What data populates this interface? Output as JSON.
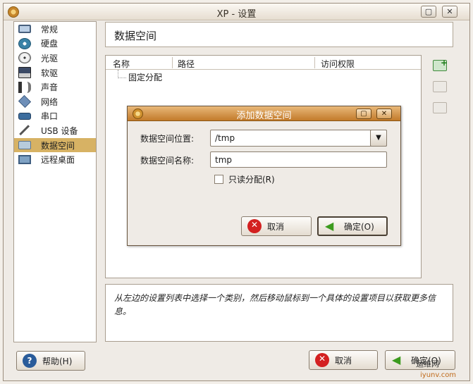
{
  "window": {
    "title": "XP - 设置",
    "controls": {
      "maximize": "▢",
      "close": "✕"
    }
  },
  "sidebar": {
    "items": [
      {
        "label": "常规",
        "icon": "computer-icon"
      },
      {
        "label": "硬盘",
        "icon": "hard-disk-icon"
      },
      {
        "label": "光驱",
        "icon": "cd-rom-icon"
      },
      {
        "label": "软驱",
        "icon": "floppy-icon"
      },
      {
        "label": "声音",
        "icon": "audio-icon"
      },
      {
        "label": "网络",
        "icon": "network-icon"
      },
      {
        "label": "串口",
        "icon": "serial-port-icon"
      },
      {
        "label": "USB 设备",
        "icon": "usb-icon"
      },
      {
        "label": "数据空间",
        "icon": "shared-folder-icon",
        "selected": true
      },
      {
        "label": "远程桌面",
        "icon": "remote-display-icon"
      }
    ]
  },
  "header": {
    "title": "数据空间"
  },
  "table": {
    "columns": [
      "名称",
      "路径",
      "访问权限"
    ],
    "rows": [
      {
        "name": "固定分配"
      }
    ]
  },
  "info": {
    "text": "从左边的设置列表中选择一个类别，然后移动鼠标到一个具体的设置项目以获取更多信息。"
  },
  "buttons": {
    "help": "帮助(H)",
    "cancel": "取消",
    "ok": "确定(O)"
  },
  "watermark": {
    "line1": "运维网",
    "line2": "iyunv.com"
  },
  "dialog": {
    "title": "添加数据空间",
    "location_label": "数据空间位置:",
    "location_value": "/tmp",
    "name_label": "数据空间名称:",
    "name_value": "tmp",
    "readonly_label": "只读分配(R)",
    "readonly_checked": false,
    "cancel": "取消",
    "ok": "确定(O)"
  },
  "colors": {
    "selection": "#d7b264",
    "dialog_titlebar": "#c27a2a",
    "window_bg": "#efebe6"
  }
}
